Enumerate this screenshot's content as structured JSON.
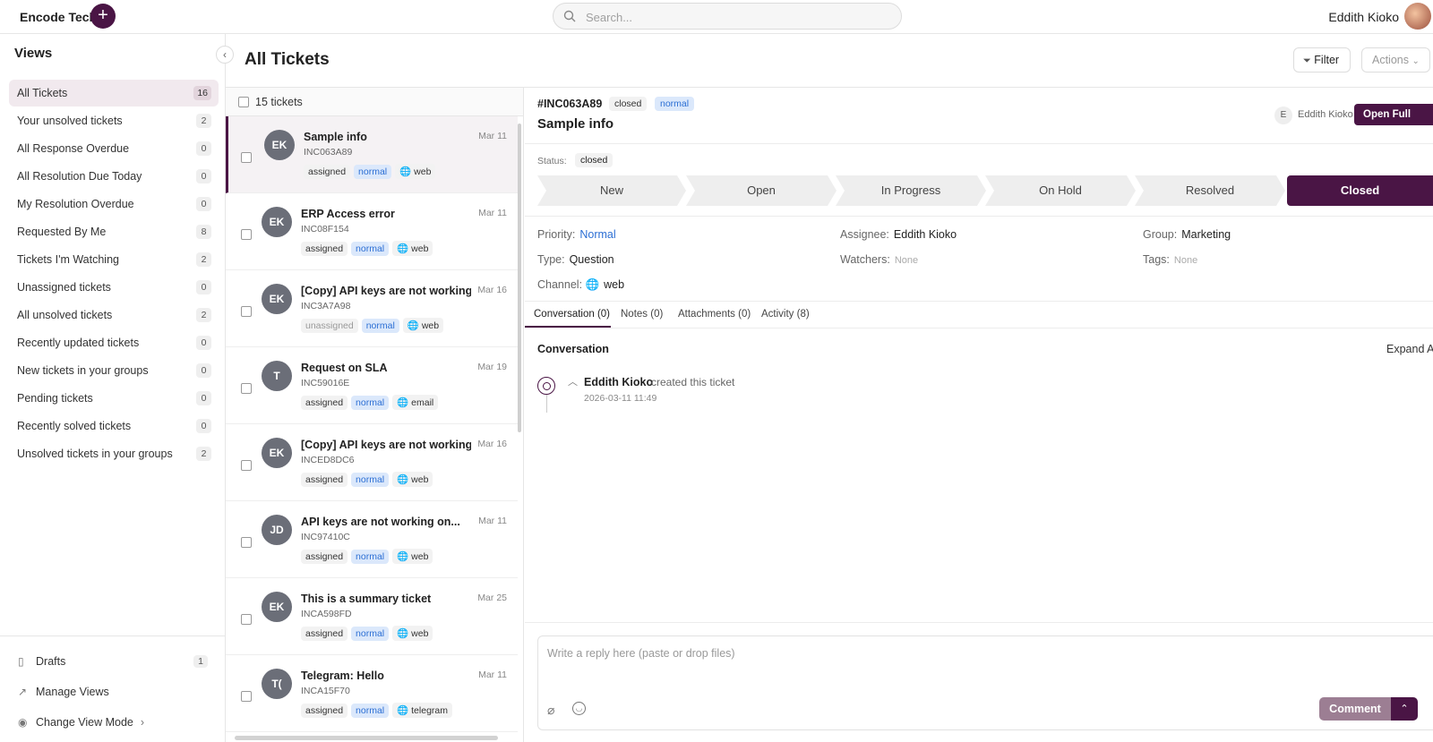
{
  "app": {
    "brand": "Encode Tech",
    "search_placeholder": "Search...",
    "user_name": "Eddith Kioko"
  },
  "sidebar": {
    "title": "Views",
    "items": [
      {
        "label": "All Tickets",
        "count": "16"
      },
      {
        "label": "Your unsolved tickets",
        "count": "2"
      },
      {
        "label": "All Response Overdue",
        "count": "0"
      },
      {
        "label": "All Resolution Due Today",
        "count": "0"
      },
      {
        "label": "My Resolution Overdue",
        "count": "0"
      },
      {
        "label": "Requested By Me",
        "count": "8"
      },
      {
        "label": "Tickets I'm Watching",
        "count": "2"
      },
      {
        "label": "Unassigned tickets",
        "count": "0"
      },
      {
        "label": "All unsolved tickets",
        "count": "2"
      },
      {
        "label": "Recently updated tickets",
        "count": "0"
      },
      {
        "label": "New tickets in your groups",
        "count": "0"
      },
      {
        "label": "Pending tickets",
        "count": "0"
      },
      {
        "label": "Recently solved tickets",
        "count": "0"
      },
      {
        "label": "Unsolved tickets in your groups",
        "count": "2"
      }
    ],
    "drafts_label": "Drafts",
    "drafts_count": "1",
    "manage_views_label": "Manage Views",
    "change_view_mode_label": "Change View Mode"
  },
  "header": {
    "title": "All Tickets",
    "filter_label": "Filter",
    "actions_label": "Actions"
  },
  "list": {
    "count_label": "15 tickets",
    "tickets": [
      {
        "initials": "EK",
        "title": "Sample info",
        "id": "INC063A89",
        "date": "Mar 11",
        "status": "assigned",
        "priority": "normal",
        "channel": "web"
      },
      {
        "initials": "EK",
        "title": "ERP Access error",
        "id": "INC08F154",
        "date": "Mar 11",
        "status": "assigned",
        "priority": "normal",
        "channel": "web"
      },
      {
        "initials": "EK",
        "title": "[Copy] API keys are not working...",
        "id": "INC3A7A98",
        "date": "Mar 16",
        "status": "unassigned",
        "priority": "normal",
        "channel": "web"
      },
      {
        "initials": "T",
        "title": "Request on SLA",
        "id": "INC59016E",
        "date": "Mar 19",
        "status": "assigned",
        "priority": "normal",
        "channel": "email"
      },
      {
        "initials": "EK",
        "title": "[Copy] API keys are not working...",
        "id": "INCED8DC6",
        "date": "Mar 16",
        "status": "assigned",
        "priority": "normal",
        "channel": "web"
      },
      {
        "initials": "JD",
        "title": "API keys are not working on...",
        "id": "INC97410C",
        "date": "Mar 11",
        "status": "assigned",
        "priority": "normal",
        "channel": "web"
      },
      {
        "initials": "EK",
        "title": "This is a summary ticket",
        "id": "INCA598FD",
        "date": "Mar 25",
        "status": "assigned",
        "priority": "normal",
        "channel": "web"
      },
      {
        "initials": "T(",
        "title": "Telegram: Hello",
        "id": "INCA15F70",
        "date": "Mar 11",
        "status": "assigned",
        "priority": "normal",
        "channel": "telegram"
      }
    ]
  },
  "detail": {
    "id": "#INC063A89",
    "status_badge": "closed",
    "priority_badge": "normal",
    "title": "Sample info",
    "assignee_initial": "E",
    "assignee_name": "Eddith Kioko",
    "open_full_view_label": "Open Full View",
    "status_label": "Status:",
    "status_value": "closed",
    "steps": [
      "New",
      "Open",
      "In Progress",
      "On Hold",
      "Resolved",
      "Closed"
    ],
    "fields": {
      "priority_label": "Priority:",
      "priority_value": "Normal",
      "assignee_label": "Assignee:",
      "assignee_value": "Eddith Kioko",
      "group_label": "Group:",
      "group_value": "Marketing",
      "type_label": "Type:",
      "type_value": "Question",
      "watchers_label": "Watchers:",
      "watchers_value": "None",
      "tags_label": "Tags:",
      "tags_value": "None",
      "channel_label": "Channel:",
      "channel_value": "web"
    },
    "tabs": [
      "Conversation (0)",
      "Notes (0)",
      "Attachments (0)",
      "Activity (8)"
    ],
    "conversation_title": "Conversation",
    "expand_all_label": "Expand All",
    "timeline": {
      "name": "Eddith Kioko",
      "action": "created this ticket",
      "time": "2026-03-11 11:49"
    },
    "reply_placeholder": "Write a reply here (paste or drop files)",
    "comment_label": "Comment"
  },
  "colors": {
    "accent": "#4a1545",
    "priority_blue": "#2c6fd4"
  }
}
